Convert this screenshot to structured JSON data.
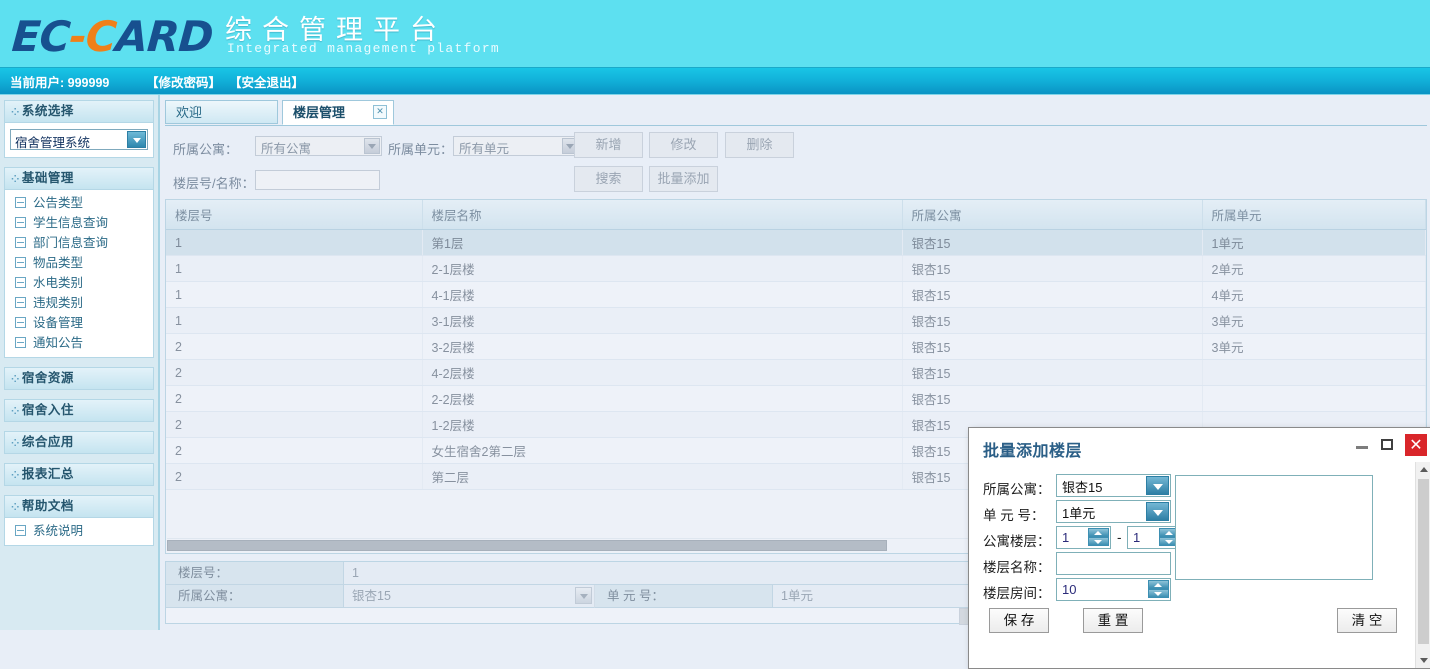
{
  "header": {
    "logo_part1": "EC",
    "logo_dash": "-C",
    "logo_part2": "ARD",
    "brand_cn": "综合管理平台",
    "brand_en": "Integrated management platform"
  },
  "userbar": {
    "current_user": "当前用户: 999999",
    "change_password": "【修改密码】",
    "logout": "【安全退出】"
  },
  "sidebar": {
    "system_select": {
      "title": "系统选择",
      "value": "宿舍管理系统"
    },
    "groups": [
      {
        "title": "基础管理",
        "items": [
          "公告类型",
          "学生信息查询",
          "部门信息查询",
          "物品类型",
          "水电类别",
          "违规类别",
          "设备管理",
          "通知公告"
        ]
      },
      {
        "title": "宿舍资源",
        "items": []
      },
      {
        "title": "宿舍入住",
        "items": []
      },
      {
        "title": "综合应用",
        "items": []
      },
      {
        "title": "报表汇总",
        "items": []
      },
      {
        "title": "帮助文档",
        "items": [
          "系统说明"
        ]
      }
    ]
  },
  "tabs": [
    {
      "label": "欢迎",
      "active": false,
      "closable": false
    },
    {
      "label": "楼层管理",
      "active": true,
      "closable": true
    }
  ],
  "toolbar": {
    "apartment_label": "所属公寓：",
    "apartment_value": "所有公寓",
    "unit_label": "所属单元：",
    "unit_value": "所有单元",
    "floorname_label": "楼层号/名称：",
    "floorname_value": "",
    "btn_add": "新增",
    "btn_edit": "修改",
    "btn_delete": "删除",
    "btn_search": "搜索",
    "btn_batch_add": "批量添加"
  },
  "grid": {
    "columns": [
      "楼层号",
      "楼层名称",
      "所属公寓",
      "所属单元"
    ],
    "rows": [
      {
        "floor_no": "1",
        "floor_name": "第1层",
        "apartment": "银杏15",
        "unit": "1单元",
        "selected": true
      },
      {
        "floor_no": "1",
        "floor_name": "2-1层楼",
        "apartment": "银杏15",
        "unit": "2单元",
        "selected": false
      },
      {
        "floor_no": "1",
        "floor_name": "4-1层楼",
        "apartment": "银杏15",
        "unit": "4单元",
        "selected": false
      },
      {
        "floor_no": "1",
        "floor_name": "3-1层楼",
        "apartment": "银杏15",
        "unit": "3单元",
        "selected": false
      },
      {
        "floor_no": "2",
        "floor_name": "3-2层楼",
        "apartment": "银杏15",
        "unit": "3单元",
        "selected": false
      },
      {
        "floor_no": "2",
        "floor_name": "4-2层楼",
        "apartment": "银杏15",
        "unit": "",
        "selected": false
      },
      {
        "floor_no": "2",
        "floor_name": "2-2层楼",
        "apartment": "银杏15",
        "unit": "",
        "selected": false
      },
      {
        "floor_no": "2",
        "floor_name": "1-2层楼",
        "apartment": "银杏15",
        "unit": "",
        "selected": false
      },
      {
        "floor_no": "2",
        "floor_name": "女生宿舍2第二层",
        "apartment": "银杏15",
        "unit": "",
        "selected": false
      },
      {
        "floor_no": "2",
        "floor_name": "第二层",
        "apartment": "银杏15",
        "unit": "",
        "selected": false
      }
    ]
  },
  "detail": {
    "floor_no_label": "楼层号：",
    "floor_no_value": "1",
    "apartment_label": "所属公寓：",
    "apartment_value": "银杏15",
    "unit_label": "单 元 号：",
    "unit_value": "1单元"
  },
  "modal": {
    "title": "批量添加楼层",
    "minimize_icon": "minimize-icon",
    "maximize_icon": "maximize-icon",
    "close_icon": "close-icon",
    "apartment_label": "所属公寓：",
    "apartment_value": "银杏15",
    "unit_label": "单 元 号：",
    "unit_value": "1单元",
    "floor_range_label": "公寓楼层：",
    "floor_from": "1",
    "floor_sep": "-",
    "floor_to": "1",
    "floor_name_label": "楼层名称：",
    "floor_name_value": "",
    "room_count_label": "楼层房间：",
    "room_count_value": "10",
    "btn_save": "保 存",
    "btn_reset": "重 置",
    "btn_clear": "清 空",
    "log_value": ""
  },
  "colors": {
    "header_bg": "#5de0f0",
    "userbar_bg": "#12b2da",
    "logo_blue": "#17508f",
    "logo_orange": "#ef8019",
    "sidebar_bg": "#d8eaf2",
    "accent": "#2f7fa5",
    "close_red": "#d9262a"
  }
}
